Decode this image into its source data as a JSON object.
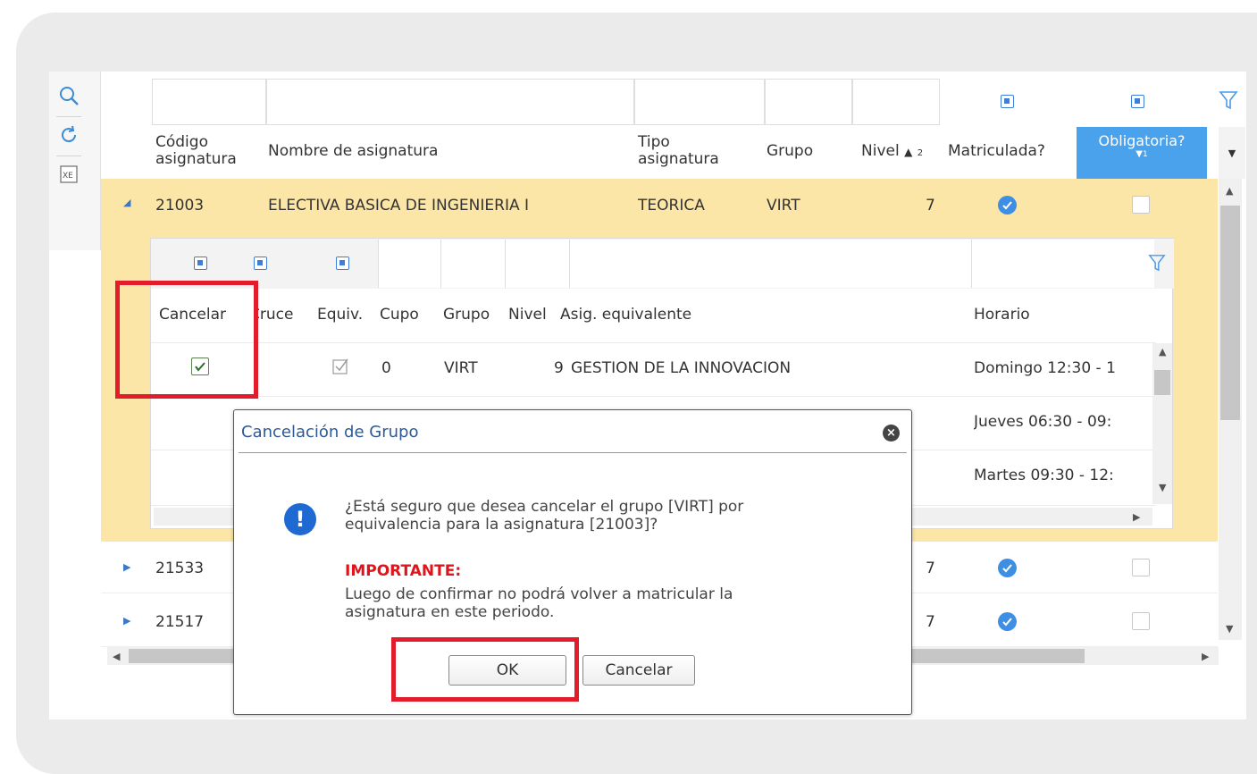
{
  "grid": {
    "columns": {
      "codigo": "Código\nasignatura",
      "codigo_l1": "Código",
      "codigo_l2": "asignatura",
      "nombre": "Nombre de asignatura",
      "tipo_l1": "Tipo",
      "tipo_l2": "asignatura",
      "grupo": "Grupo",
      "nivel": "Nivel",
      "nivel_sort_index": "2",
      "matriculada": "Matriculada?",
      "obligatoria": "Obligatoria?",
      "obligatoria_sort_index": "1"
    },
    "rows": [
      {
        "codigo": "21003",
        "nombre": "ELECTIVA BASICA DE INGENIERIA I",
        "tipo": "TEORICA",
        "grupo": "VIRT",
        "nivel": "7",
        "matriculada": true,
        "obligatoria": false,
        "expanded": true
      },
      {
        "codigo": "21533",
        "nivel": "7",
        "matriculada": true,
        "obligatoria": false,
        "expanded": false
      },
      {
        "codigo": "21517",
        "nivel": "7",
        "matriculada": true,
        "obligatoria": false,
        "expanded": false
      }
    ]
  },
  "nested": {
    "columns": {
      "cancelar": "Cancelar",
      "cruce": "Cruce",
      "equiv": "Equiv.",
      "cupo": "Cupo",
      "grupo": "Grupo",
      "nivel": "Nivel",
      "asig_equivalente": "Asig. equivalente",
      "horario": "Horario"
    },
    "rows": [
      {
        "cancelar": true,
        "equiv": true,
        "cupo": "0",
        "grupo": "VIRT",
        "nivel": "9",
        "asig_equivalente": "GESTION DE LA INNOVACION",
        "horario": "Domingo 12:30 - 1"
      },
      {
        "horario": "Jueves 06:30 - 09:"
      },
      {
        "horario": "Martes 09:30 - 12:"
      }
    ]
  },
  "dialog": {
    "title": "Cancelación de Grupo",
    "message_l1": "¿Está seguro que desea cancelar el grupo [VIRT] por",
    "message_l2": "equivalencia para la asignatura [21003]?",
    "important_label": "IMPORTANTE:",
    "warning_l1": "Luego de confirmar no podrá volver a matricular la",
    "warning_l2": "asignatura en este periodo.",
    "ok_label": "OK",
    "cancel_label": "Cancelar",
    "info_glyph": "!",
    "close_glyph": "×"
  },
  "icons": {
    "search": "search-icon",
    "refresh": "refresh-icon",
    "excel": "excel-export-icon",
    "filter": "filter-icon"
  },
  "colors": {
    "selected_row": "#fbe6a7",
    "header_active": "#4aa2ec",
    "highlight": "#e21c2a",
    "dialog_title": "#2d5a97",
    "info_icon": "#1e69d2",
    "important": "#e0141c"
  }
}
